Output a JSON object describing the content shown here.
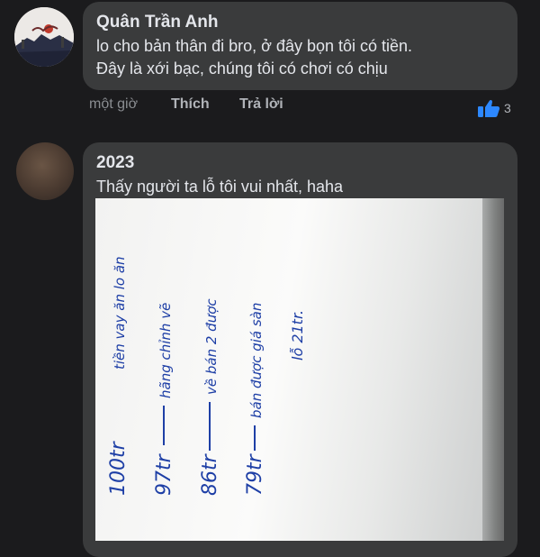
{
  "comments": [
    {
      "author": "Quân Trần Anh",
      "text_line1": "lo cho bản thân đi bro, ở đây bọn tôi có tiền.",
      "text_line2": "Đây là xới bạc, chúng tôi có chơi có chịu",
      "time": "một giờ",
      "like_label": "Thích",
      "reply_label": "Trả lời",
      "reaction_count": "3",
      "reaction_icon": "thumbs-up-icon",
      "reaction_color": "#2d88ff"
    },
    {
      "author": "2023",
      "text_line1": "Thấy người ta lỗ tôi vui nhất, haha",
      "photo": {
        "handwritten_note": [
          "100tr",
          "tiền vay ăn lo ăn",
          "97tr",
          "hãng chỉnh vẽ",
          "86tr",
          "về bán 2 được",
          "79tr",
          "bán được giá sàn",
          "lỗ 21tr."
        ]
      }
    }
  ],
  "colors": {
    "background": "#1b1b1d",
    "bubble": "#3a3b3c",
    "text": "#e4e6eb",
    "muted": "#b0b3b8",
    "ink": "#1e3fa6"
  }
}
